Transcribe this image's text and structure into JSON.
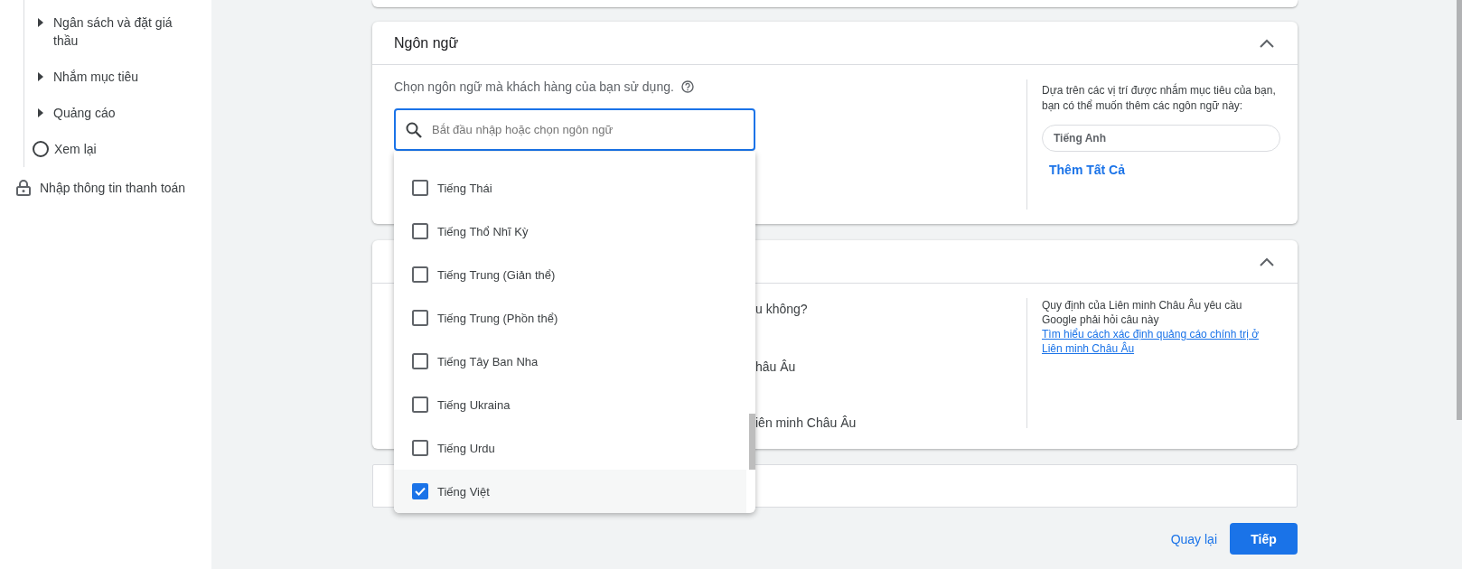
{
  "sidebar": {
    "steps": [
      {
        "kind": "section",
        "label": "Ngân sách và đặt giá thầu"
      },
      {
        "kind": "section",
        "label": "Nhắm mục tiêu"
      },
      {
        "kind": "section",
        "label": "Quảng cáo"
      },
      {
        "kind": "step",
        "label": "Xem lại"
      }
    ],
    "locked_item": {
      "label": "Nhập thông tin thanh toán"
    }
  },
  "language_card": {
    "title": "Ngôn ngữ",
    "expanded": true,
    "prompt": "Chọn ngôn ngữ mà khách hàng của bạn sử dụng.",
    "search": {
      "placeholder": "Bắt đầu nhập hoặc chọn ngôn ngữ"
    },
    "suggestion_text": "Dựa trên các vị trí được nhắm mục tiêu của bạn, bạn có thể muốn thêm các ngôn ngữ này:",
    "suggestions": [
      "Tiếng Anh"
    ],
    "add_all": "Thêm Tất Cả"
  },
  "language_dropdown": {
    "options": [
      {
        "label": "Tiếng Thái",
        "checked": false
      },
      {
        "label": "Tiếng Thổ Nhĩ Kỳ",
        "checked": false
      },
      {
        "label": "Tiếng Trung (Giản thể)",
        "checked": false
      },
      {
        "label": "Tiếng Trung (Phồn thể)",
        "checked": false
      },
      {
        "label": "Tiếng Tây Ban Nha",
        "checked": false
      },
      {
        "label": "Tiếng Ukraina",
        "checked": false
      },
      {
        "label": "Tiếng Urdu",
        "checked": false
      },
      {
        "label": "Tiếng Việt",
        "checked": true
      }
    ]
  },
  "eu_card": {
    "expanded": true,
    "question": "u không?",
    "options": [
      "hâu Âu",
      "iên minh Châu Âu"
    ],
    "note": "Quy định của Liên minh Châu Âu yêu cầu Google phải hỏi câu này",
    "link": "Tìm hiểu cách xác định quảng cáo chính trị ở Liên minh Châu Âu"
  },
  "footer": {
    "back": "Quay lại",
    "next": "Tiếp"
  }
}
